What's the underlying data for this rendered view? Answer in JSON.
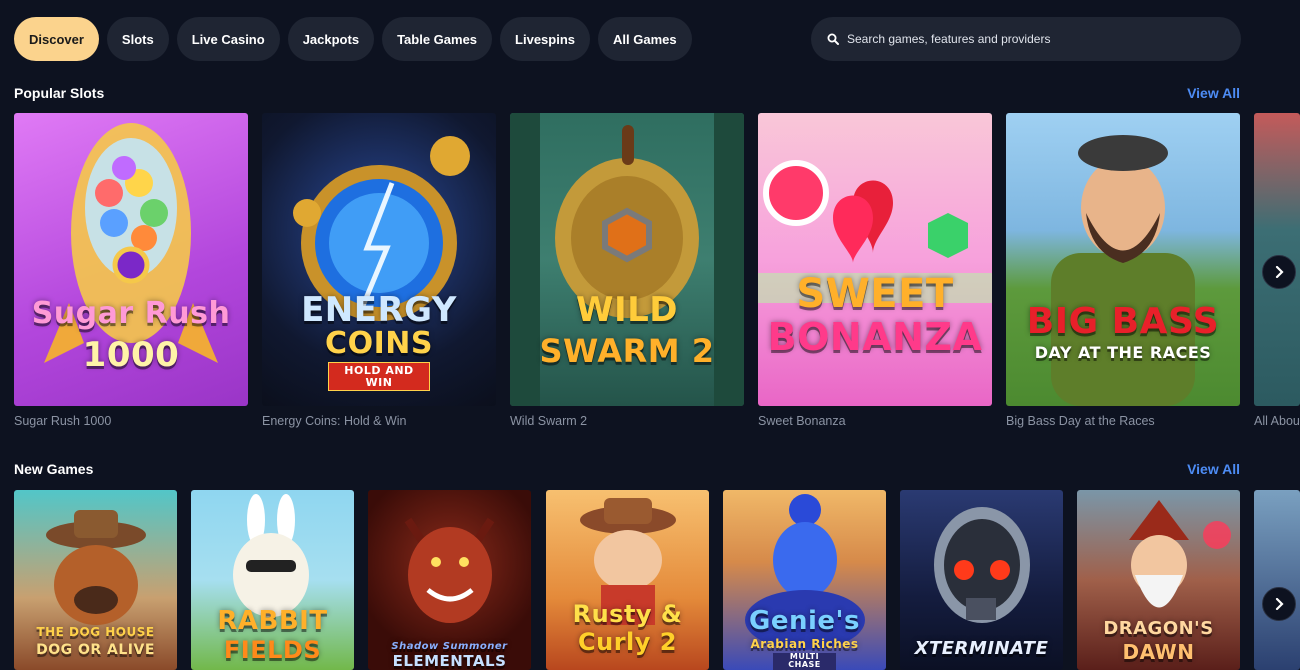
{
  "nav": {
    "tabs": [
      {
        "label": "Discover",
        "active": true
      },
      {
        "label": "Slots"
      },
      {
        "label": "Live Casino"
      },
      {
        "label": "Jackpots"
      },
      {
        "label": "Table Games"
      },
      {
        "label": "Livespins"
      },
      {
        "label": "All Games"
      }
    ]
  },
  "search": {
    "placeholder": "Search games, features and providers",
    "icon": "search-icon"
  },
  "popular": {
    "title": "Popular Slots",
    "view_all": "View All",
    "games": [
      {
        "name": "Sugar Rush 1000",
        "logo_line1": "Sugar Rush",
        "logo_line2": "1000",
        "colors": [
          "#d66bf0",
          "#a23ccf"
        ]
      },
      {
        "name": "Energy Coins: Hold & Win",
        "logo_line1": "ENERGY",
        "logo_line2": "COINS",
        "logo_tag": "HOLD AND WIN",
        "colors": [
          "#1d2a48",
          "#0c1020"
        ]
      },
      {
        "name": "Wild Swarm 2",
        "logo_line1": "WILD",
        "logo_line2": "SWARM 2",
        "colors": [
          "#3a7a6a",
          "#1d4a3a"
        ]
      },
      {
        "name": "Sweet Bonanza",
        "logo_line1": "SWEET",
        "logo_line2": "BONANZA",
        "colors": [
          "#f5a6e0",
          "#e96fc9"
        ]
      },
      {
        "name": "Big Bass Day at the Races",
        "logo_line1": "BIG BASS",
        "logo_line2": "DAY AT THE RACES",
        "colors": [
          "#8fc5ee",
          "#5e9c3a"
        ]
      },
      {
        "name": "All Abou",
        "colors": [
          "#7a9aa6",
          "#3c5e64"
        ]
      }
    ]
  },
  "newgames": {
    "title": "New Games",
    "view_all": "View All",
    "games": [
      {
        "logo_line1": "THE DOG HOUSE",
        "logo_line2": "DOG OR ALIVE",
        "colors": [
          "#4fc1c4",
          "#b35a3a"
        ]
      },
      {
        "logo_line1": "RABBIT",
        "logo_line2": "FIELDS",
        "colors": [
          "#79c9e6",
          "#6ab24a"
        ]
      },
      {
        "logo_line1": "Shadow Summoner",
        "logo_line2": "ELEMENTALS",
        "colors": [
          "#5a1414",
          "#1a0808"
        ]
      },
      {
        "logo_line1": "Rusty &",
        "logo_line2": "Curly 2",
        "colors": [
          "#f4b860",
          "#b8471e"
        ]
      },
      {
        "logo_line1": "Genie's",
        "logo_line2": "Arabian Riches",
        "logo_tag": "MULTI CHASE",
        "colors": [
          "#e3a457",
          "#3b4ab8"
        ]
      },
      {
        "logo_line1": "",
        "logo_line2": "XTERMINATE",
        "colors": [
          "#24305f",
          "#0b1024"
        ]
      },
      {
        "logo_line1": "DRAGON'S",
        "logo_line2": "DAWN",
        "colors": [
          "#6f8da0",
          "#5a1f1a"
        ]
      },
      {
        "logo_line1": "",
        "logo_line2": "",
        "colors": [
          "#6a8fb0",
          "#2b4070"
        ]
      }
    ]
  },
  "arrows": {
    "icon": "chevron-right-icon"
  }
}
